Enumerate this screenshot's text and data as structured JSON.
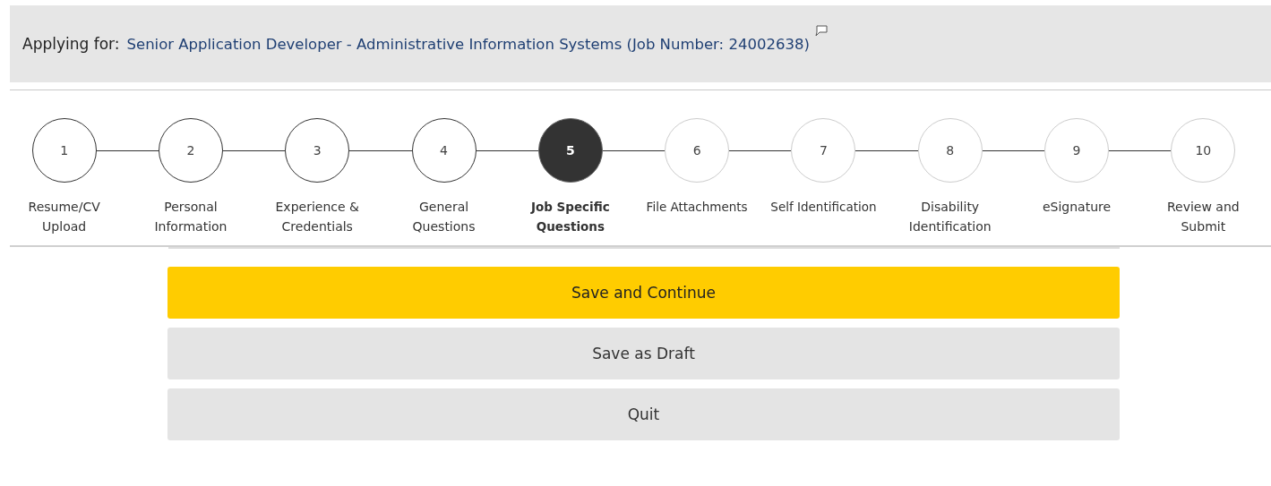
{
  "header": {
    "label": "Applying for:",
    "job_title": "Senior Application Developer - Administrative Information Systems (Job Number: 24002638)"
  },
  "steps": [
    {
      "number": "1",
      "label": "Resume/CV Upload",
      "completed": true,
      "selected": false
    },
    {
      "number": "2",
      "label": "Personal Information",
      "completed": true,
      "selected": false
    },
    {
      "number": "3",
      "label": "Experience & Credentials",
      "completed": true,
      "selected": false
    },
    {
      "number": "4",
      "label": "General Questions",
      "completed": true,
      "selected": false
    },
    {
      "number": "5",
      "label": "Job Specific Questions",
      "completed": false,
      "selected": true
    },
    {
      "number": "6",
      "label": "File Attachments",
      "completed": false,
      "selected": false
    },
    {
      "number": "7",
      "label": "Self Identification",
      "completed": false,
      "selected": false
    },
    {
      "number": "8",
      "label": "Disability Identification",
      "completed": false,
      "selected": false
    },
    {
      "number": "9",
      "label": "eSignature",
      "completed": false,
      "selected": false
    },
    {
      "number": "10",
      "label": "Review and Submit",
      "completed": false,
      "selected": false
    }
  ],
  "buttons": [
    {
      "label": "Save and Continue",
      "kind": "primary"
    },
    {
      "label": "Save as Draft",
      "kind": "secondary"
    },
    {
      "label": "Quit",
      "kind": "secondary"
    }
  ]
}
